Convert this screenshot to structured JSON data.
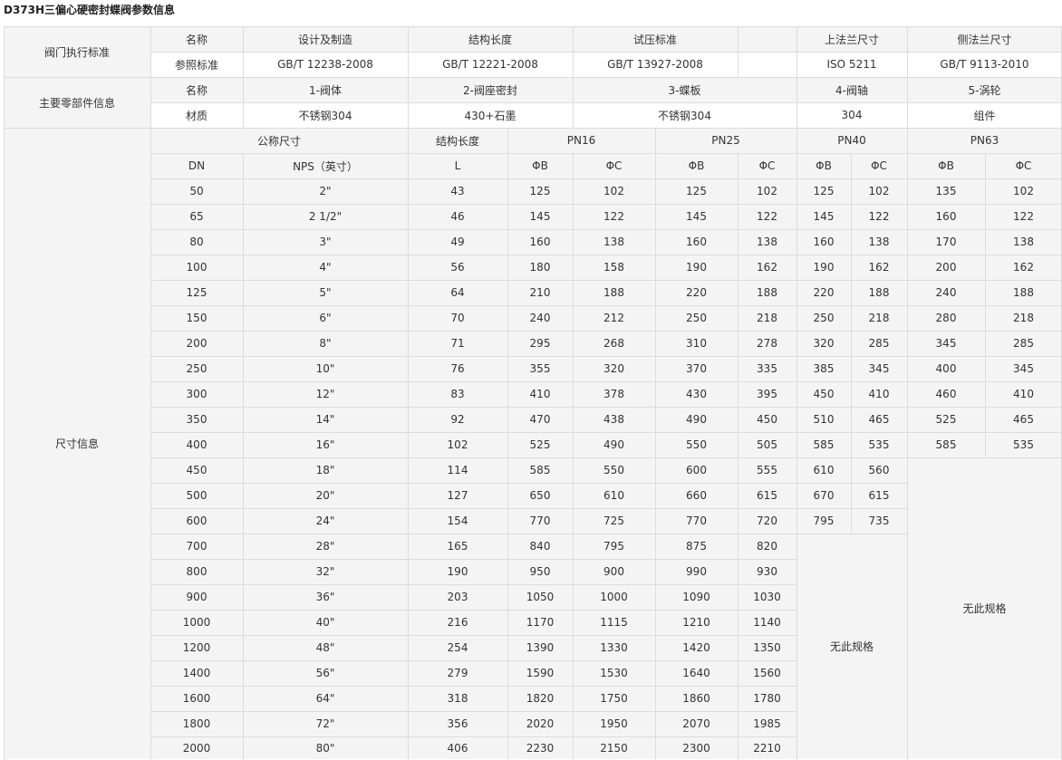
{
  "page": {
    "title": "D373H三偏心硬密封蝶阀参数信息"
  },
  "section_labels": {
    "standard": "阀门执行标准",
    "parts": "主要零部件信息",
    "dimensions": "尺寸信息"
  },
  "standard_table": {
    "header": [
      "名称",
      "设计及制造",
      "结构长度",
      "试压标准",
      "",
      "上法兰尺寸",
      "侧法兰尺寸"
    ],
    "values": [
      "参照标准",
      "GB/T 12238-2008",
      "GB/T 12221-2008",
      "GB/T 13927-2008",
      "",
      "ISO 5211",
      "GB/T 9113-2010"
    ]
  },
  "parts_table": {
    "names": [
      "名称",
      "1-阀体",
      "2-阀座密封",
      "3-蝶板",
      "4-阀轴",
      "5-涡轮"
    ],
    "materials": [
      "材质",
      "不锈钢304",
      "430+石墨",
      "不锈钢304",
      "304",
      "组件"
    ]
  },
  "dimension_table": {
    "group_headers": [
      "公称尺寸",
      "结构长度",
      "PN16",
      "PN25",
      "PN40",
      "PN63"
    ],
    "sub_headers": [
      "DN",
      "NPS（英寸）",
      "L",
      "ΦB",
      "ΦC",
      "ΦB",
      "ΦC",
      "ΦB",
      "ΦC",
      "ΦB",
      "ΦC"
    ],
    "no_spec_text": "无此规格",
    "rows": [
      [
        "50",
        "2\"",
        "43",
        "125",
        "102",
        "125",
        "102",
        "125",
        "102",
        "135",
        "102"
      ],
      [
        "65",
        "2  1/2\"",
        "46",
        "145",
        "122",
        "145",
        "122",
        "145",
        "122",
        "160",
        "122"
      ],
      [
        "80",
        "3\"",
        "49",
        "160",
        "138",
        "160",
        "138",
        "160",
        "138",
        "170",
        "138"
      ],
      [
        "100",
        "4\"",
        "56",
        "180",
        "158",
        "190",
        "162",
        "190",
        "162",
        "200",
        "162"
      ],
      [
        "125",
        "5\"",
        "64",
        "210",
        "188",
        "220",
        "188",
        "220",
        "188",
        "240",
        "188"
      ],
      [
        "150",
        "6\"",
        "70",
        "240",
        "212",
        "250",
        "218",
        "250",
        "218",
        "280",
        "218"
      ],
      [
        "200",
        "8\"",
        "71",
        "295",
        "268",
        "310",
        "278",
        "320",
        "285",
        "345",
        "285"
      ],
      [
        "250",
        "10\"",
        "76",
        "355",
        "320",
        "370",
        "335",
        "385",
        "345",
        "400",
        "345"
      ],
      [
        "300",
        "12\"",
        "83",
        "410",
        "378",
        "430",
        "395",
        "450",
        "410",
        "460",
        "410"
      ],
      [
        "350",
        "14\"",
        "92",
        "470",
        "438",
        "490",
        "450",
        "510",
        "465",
        "525",
        "465"
      ],
      [
        "400",
        "16\"",
        "102",
        "525",
        "490",
        "550",
        "505",
        "585",
        "535",
        "585",
        "535"
      ],
      [
        "450",
        "18\"",
        "114",
        "585",
        "550",
        "600",
        "555",
        "610",
        "560"
      ],
      [
        "500",
        "20\"",
        "127",
        "650",
        "610",
        "660",
        "615",
        "670",
        "615"
      ],
      [
        "600",
        "24\"",
        "154",
        "770",
        "725",
        "770",
        "720",
        "795",
        "735"
      ],
      [
        "700",
        "28\"",
        "165",
        "840",
        "795",
        "875",
        "820"
      ],
      [
        "800",
        "32\"",
        "190",
        "950",
        "900",
        "990",
        "930"
      ],
      [
        "900",
        "36\"",
        "203",
        "1050",
        "1000",
        "1090",
        "1030"
      ],
      [
        "1000",
        "40\"",
        "216",
        "1170",
        "1115",
        "1210",
        "1140"
      ],
      [
        "1200",
        "48\"",
        "254",
        "1390",
        "1330",
        "1420",
        "1350"
      ],
      [
        "1400",
        "56\"",
        "279",
        "1590",
        "1530",
        "1640",
        "1560"
      ],
      [
        "1600",
        "64\"",
        "318",
        "1820",
        "1750",
        "1860",
        "1780"
      ],
      [
        "1800",
        "72\"",
        "356",
        "2020",
        "1950",
        "2070",
        "1985"
      ],
      [
        "2000",
        "80\"",
        "406",
        "2230",
        "2150",
        "2300",
        "2210"
      ]
    ]
  },
  "colors": {
    "grid_line": "#dcdcdc",
    "header_bg": "#f4f4f4",
    "text": "#333333"
  }
}
